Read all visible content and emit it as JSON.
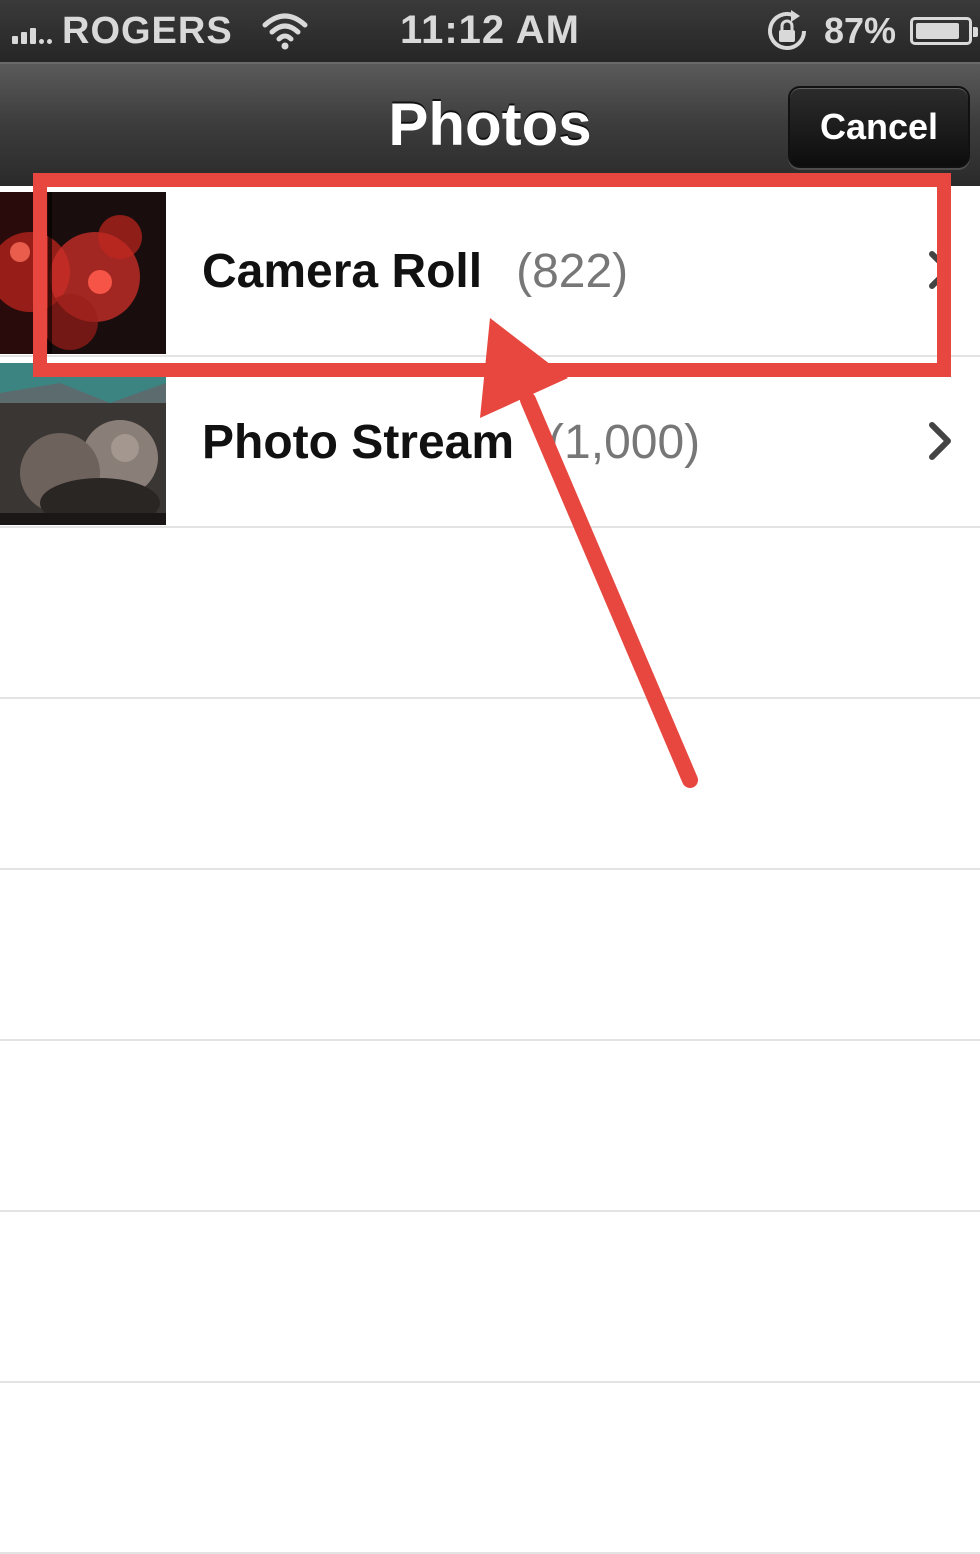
{
  "status_bar": {
    "carrier": "ROGERS",
    "time": "11:12 AM",
    "battery_percent": "87%",
    "battery_level": 0.87,
    "icons": [
      "signal-icon",
      "wifi-icon",
      "rotation-lock-icon",
      "battery-icon"
    ]
  },
  "nav": {
    "title": "Photos",
    "cancel_label": "Cancel"
  },
  "albums": [
    {
      "name": "Camera Roll",
      "count": "(822)",
      "thumb": "red-fireworks-thumbnail"
    },
    {
      "name": "Photo Stream",
      "count": "(1,000)",
      "thumb": "group-photo-thumbnail"
    }
  ],
  "annotation": {
    "color": "#e8473f",
    "highlight_target": "Camera Roll",
    "shape": "rectangle-with-arrow"
  }
}
